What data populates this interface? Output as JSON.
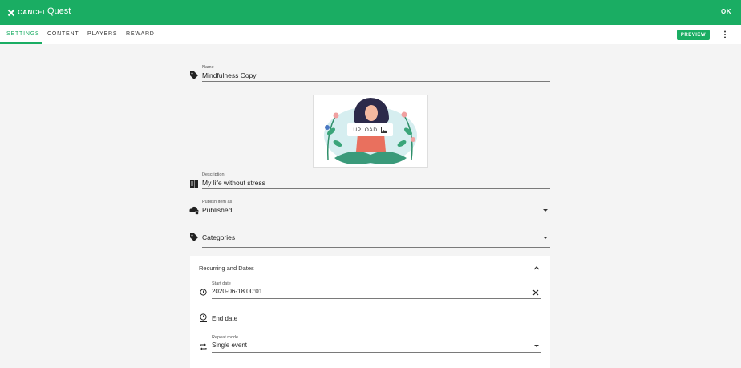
{
  "header": {
    "cancel_label": "CANCEL",
    "title": "Quest",
    "ok_label": "OK",
    "color": "#1aad63"
  },
  "tabs": [
    {
      "label": "SETTINGS",
      "active": true
    },
    {
      "label": "CONTENT",
      "active": false
    },
    {
      "label": "PLAYERS",
      "active": false
    },
    {
      "label": "REWARD",
      "active": false
    }
  ],
  "toolbar": {
    "preview_label": "PREVIEW",
    "more_icon": "more-vert-icon"
  },
  "form": {
    "name": {
      "label": "Name",
      "value": "Mindfulness Copy",
      "icon": "tag-icon"
    },
    "image": {
      "upload_label": "UPLOAD",
      "icon": "image-icon"
    },
    "description": {
      "label": "Description",
      "value": "My life without stress",
      "icon": "book-icon"
    },
    "publish": {
      "label": "Publish item as",
      "value": "Published",
      "icon": "cloud-lock-icon"
    },
    "categories": {
      "placeholder": "Categories",
      "icon": "tag-icon"
    }
  },
  "recurring": {
    "title": "Recurring and Dates",
    "start_date": {
      "label": "Start date",
      "value": "2020-06-18 00:01",
      "icon": "clock-start-icon"
    },
    "end_date": {
      "placeholder": "End date",
      "icon": "clock-end-icon"
    },
    "repeat_mode": {
      "label": "Repeat mode",
      "value": "Single event",
      "icon": "repeat-icon"
    }
  }
}
